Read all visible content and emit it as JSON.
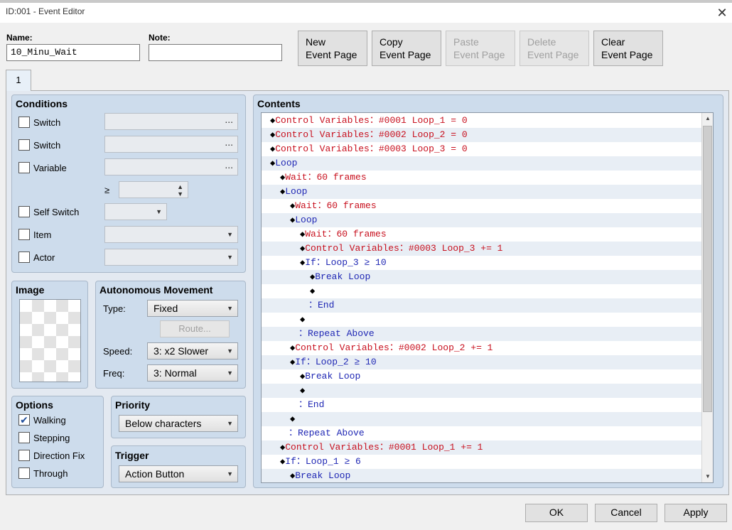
{
  "window": {
    "title": "ID:001 - Event Editor",
    "close_icon": "close-icon"
  },
  "header": {
    "name_label": "Name:",
    "name_value": "10_Minu_Wait",
    "note_label": "Note:",
    "note_value": "",
    "buttons": {
      "new": [
        "New",
        "Event Page"
      ],
      "copy": [
        "Copy",
        "Event Page"
      ],
      "paste": [
        "Paste",
        "Event Page"
      ],
      "delete": [
        "Delete",
        "Event Page"
      ],
      "clear": [
        "Clear",
        "Event Page"
      ]
    }
  },
  "tabs": [
    {
      "label": "1"
    }
  ],
  "conditions": {
    "title": "Conditions",
    "switch1": "Switch",
    "switch2": "Switch",
    "variable": "Variable",
    "gte": "≥",
    "self_switch": "Self Switch",
    "item": "Item",
    "actor": "Actor",
    "ellipsis": "..."
  },
  "image": {
    "title": "Image"
  },
  "movement": {
    "title": "Autonomous Movement",
    "type_label": "Type:",
    "type_value": "Fixed",
    "route_label": "Route...",
    "speed_label": "Speed:",
    "speed_value": "3: x2 Slower",
    "freq_label": "Freq:",
    "freq_value": "3: Normal"
  },
  "options": {
    "title": "Options",
    "walking": "Walking",
    "walking_checked": true,
    "stepping": "Stepping",
    "direction_fix": "Direction Fix",
    "through": "Through"
  },
  "priority": {
    "title": "Priority",
    "value": "Below characters"
  },
  "trigger": {
    "title": "Trigger",
    "value": "Action Button"
  },
  "contents": {
    "title": "Contents",
    "rows": [
      {
        "indent": 0,
        "diamond": true,
        "text": "Control Variables：#0001 Loop_1 = 0",
        "color": "red"
      },
      {
        "indent": 0,
        "diamond": true,
        "text": "Control Variables：#0002 Loop_2 = 0",
        "color": "red"
      },
      {
        "indent": 0,
        "diamond": true,
        "text": "Control Variables：#0003 Loop_3 = 0",
        "color": "red"
      },
      {
        "indent": 0,
        "diamond": true,
        "text": "Loop",
        "color": "blue"
      },
      {
        "indent": 1,
        "diamond": true,
        "text": "Wait：60 frames",
        "color": "red"
      },
      {
        "indent": 1,
        "diamond": true,
        "text": "Loop",
        "color": "blue"
      },
      {
        "indent": 2,
        "diamond": true,
        "text": "Wait：60 frames",
        "color": "red"
      },
      {
        "indent": 2,
        "diamond": true,
        "text": "Loop",
        "color": "blue"
      },
      {
        "indent": 3,
        "diamond": true,
        "text": "Wait：60 frames",
        "color": "red"
      },
      {
        "indent": 3,
        "diamond": true,
        "text": "Control Variables：#0003 Loop_3 += 1",
        "color": "red"
      },
      {
        "indent": 3,
        "diamond": true,
        "text": "If：Loop_3 ≥ 10",
        "color": "blue"
      },
      {
        "indent": 4,
        "diamond": true,
        "text": "Break Loop",
        "color": "blue"
      },
      {
        "indent": 4,
        "diamond": true,
        "text": "",
        "color": "blk"
      },
      {
        "indent": 3,
        "diamond": false,
        "text": "：End",
        "color": "blue"
      },
      {
        "indent": 3,
        "diamond": true,
        "text": "",
        "color": "blk"
      },
      {
        "indent": 2,
        "diamond": false,
        "text": "：Repeat Above",
        "color": "blue"
      },
      {
        "indent": 2,
        "diamond": true,
        "text": "Control Variables：#0002 Loop_2 += 1",
        "color": "red"
      },
      {
        "indent": 2,
        "diamond": true,
        "text": "If：Loop_2 ≥ 10",
        "color": "blue"
      },
      {
        "indent": 3,
        "diamond": true,
        "text": "Break Loop",
        "color": "blue"
      },
      {
        "indent": 3,
        "diamond": true,
        "text": "",
        "color": "blk"
      },
      {
        "indent": 2,
        "diamond": false,
        "text": "：End",
        "color": "blue"
      },
      {
        "indent": 2,
        "diamond": true,
        "text": "",
        "color": "blk"
      },
      {
        "indent": 1,
        "diamond": false,
        "text": "：Repeat Above",
        "color": "blue"
      },
      {
        "indent": 1,
        "diamond": true,
        "text": "Control Variables：#0001 Loop_1 += 1",
        "color": "red"
      },
      {
        "indent": 1,
        "diamond": true,
        "text": "If：Loop_1 ≥ 6",
        "color": "blue"
      },
      {
        "indent": 2,
        "diamond": true,
        "text": "Break Loop",
        "color": "blue"
      }
    ]
  },
  "footer": {
    "ok": "OK",
    "cancel": "Cancel",
    "apply": "Apply"
  },
  "colors": {
    "command_red": "#c8101e",
    "command_blue": "#1f27b4",
    "panel": "#cddcec"
  }
}
